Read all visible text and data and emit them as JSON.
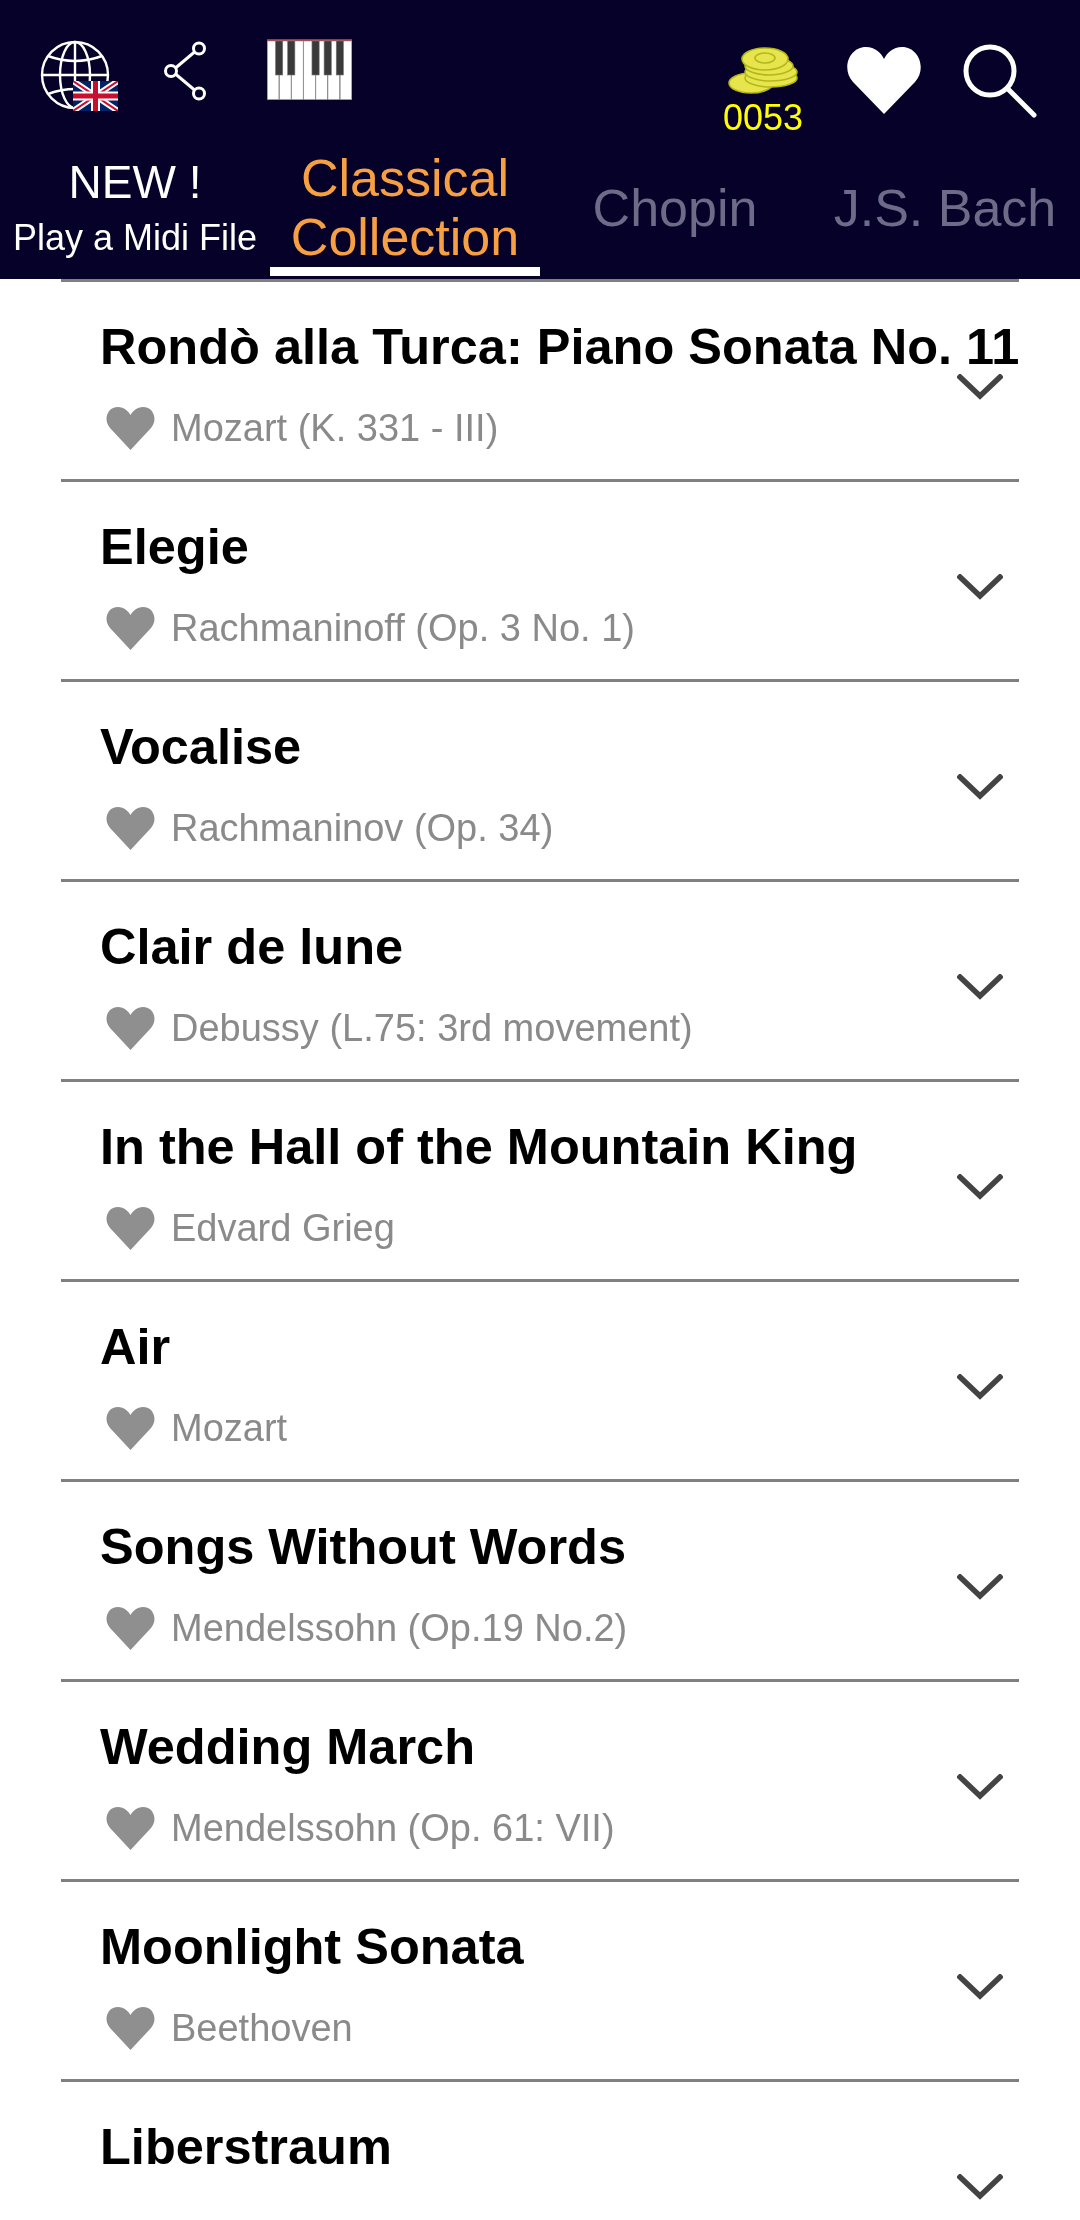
{
  "toolbar": {
    "coins": "0053"
  },
  "tabs": [
    {
      "kind": "promo",
      "label": "NEW !",
      "caption": "Play a Midi File",
      "selected": false
    },
    {
      "kind": "category",
      "label": "Classical Collection",
      "selected": true
    },
    {
      "kind": "category",
      "label": "Chopin",
      "selected": false
    },
    {
      "kind": "category",
      "label": "J.S. Bach",
      "selected": false
    }
  ],
  "songs": [
    {
      "title": "Rondò alla Turca: Piano Sonata No. 11",
      "composer": "Mozart (K. 331 - III)",
      "favorite": false,
      "expanded": false
    },
    {
      "title": "Elegie",
      "composer": "Rachmaninoff (Op. 3 No. 1)",
      "favorite": false,
      "expanded": false
    },
    {
      "title": "Vocalise",
      "composer": "Rachmaninov (Op. 34)",
      "favorite": false,
      "expanded": false
    },
    {
      "title": "Clair de lune",
      "composer": "Debussy (L.75: 3rd movement)",
      "favorite": false,
      "expanded": false
    },
    {
      "title": "In the Hall of the Mountain King",
      "composer": "Edvard Grieg",
      "favorite": false,
      "expanded": false
    },
    {
      "title": "Air",
      "composer": "Mozart",
      "favorite": false,
      "expanded": false
    },
    {
      "title": "Songs Without Words",
      "composer": "Mendelssohn (Op.19 No.2)",
      "favorite": false,
      "expanded": false
    },
    {
      "title": "Wedding March",
      "composer": "Mendelssohn (Op. 61: VII)",
      "favorite": false,
      "expanded": false
    },
    {
      "title": "Moonlight Sonata",
      "composer": "Beethoven",
      "favorite": false,
      "expanded": false
    },
    {
      "title": "Liberstraum",
      "expanded": false
    }
  ]
}
